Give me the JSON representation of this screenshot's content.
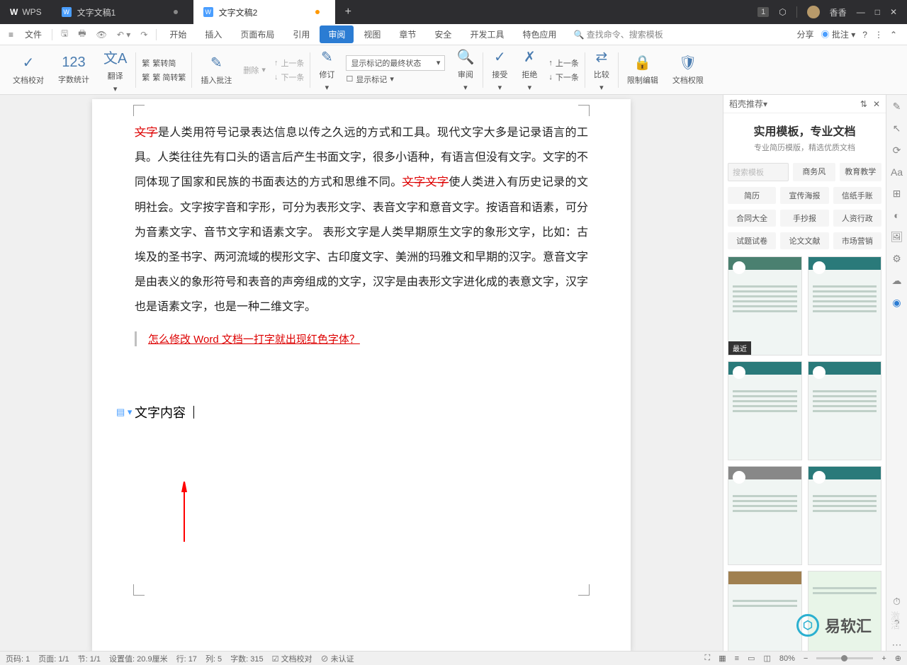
{
  "titlebar": {
    "app": "WPS",
    "tabs": [
      {
        "label": "文字文稿1",
        "active": false
      },
      {
        "label": "文字文稿2",
        "active": true
      }
    ],
    "notif_count": "1",
    "user": "香香"
  },
  "menubar": {
    "file": "文件",
    "tabs": [
      "开始",
      "插入",
      "页面布局",
      "引用",
      "审阅",
      "视图",
      "章节",
      "安全",
      "开发工具",
      "特色应用"
    ],
    "active_tab": "审阅",
    "search_placeholder": "查找命令、搜索模板",
    "share": "分享",
    "annotate": "批注"
  },
  "ribbon": {
    "proofing": "文档校对",
    "word_count": "字数统计",
    "translate": "翻译",
    "simp_trad": "繁 简转繁",
    "trad_simp": "繁转简",
    "insert_comment": "插入批注",
    "delete": "删除",
    "prev": "上一条",
    "next": "下一条",
    "track": "修订",
    "markup_combo": "显示标记的最终状态",
    "show_markup": "显示标记",
    "review": "审阅",
    "accept": "接受",
    "reject": "拒绝",
    "prev2": "上一条",
    "next2": "下一条",
    "compare": "比较",
    "restrict": "限制编辑",
    "doc_perm": "文档权限"
  },
  "document": {
    "strike1": "文字",
    "para": "是人类用符号记录表达信息以传之久远的方式和工具。现代文字大多是记录语言的工具。人类往往先有口头的语言后产生书面文字，很多小语种，有语言但没有文字。文字的不同体现了国家和民族的书面表达的方式和思维不同。",
    "strike2": "文字文字",
    "para2": "使人类进入有历史记录的文明社会。文字按字音和字形，可分为表形文字、表音文字和意音文字。按语音和语素，可分为音素文字、音节文字和语素文字。 表形文字是人类早期原生文字的象形文字，比如：古埃及的圣书字、两河流域的楔形文字、古印度文字、美洲的玛雅文和早期的汉字。意音文字是由表义的象形符号和表音的声旁组成的文字，汉字是由表形文字进化成的表意文字，汉字也是语素文字，也是一种二维文字。",
    "quote": "怎么修改 Word 文档一打字就出现红色字体？",
    "heading": "文字内容"
  },
  "sidepanel": {
    "header": "稻壳推荐",
    "title": "实用模板，专业文档",
    "subtitle": "专业简历模版，精选优质文档",
    "search": "搜索模板",
    "cats1": [
      "商务风",
      "教育教学"
    ],
    "cats2": [
      "简历",
      "宣传海报",
      "信纸手账"
    ],
    "cats3": [
      "合同大全",
      "手抄报",
      "人资行政"
    ],
    "cats4": [
      "试题试卷",
      "论文文献",
      "市场营销"
    ],
    "recent": "最近"
  },
  "statusbar": {
    "page": "页码: 1",
    "pages": "页面: 1/1",
    "section": "节: 1/1",
    "setval": "设置值: 20.9厘米",
    "line": "行: 17",
    "col": "列: 5",
    "chars": "字数: 315",
    "proof": "文档校对",
    "auth": "未认证",
    "zoom": "80%"
  },
  "watermark": "易软汇",
  "ghost": "激活"
}
